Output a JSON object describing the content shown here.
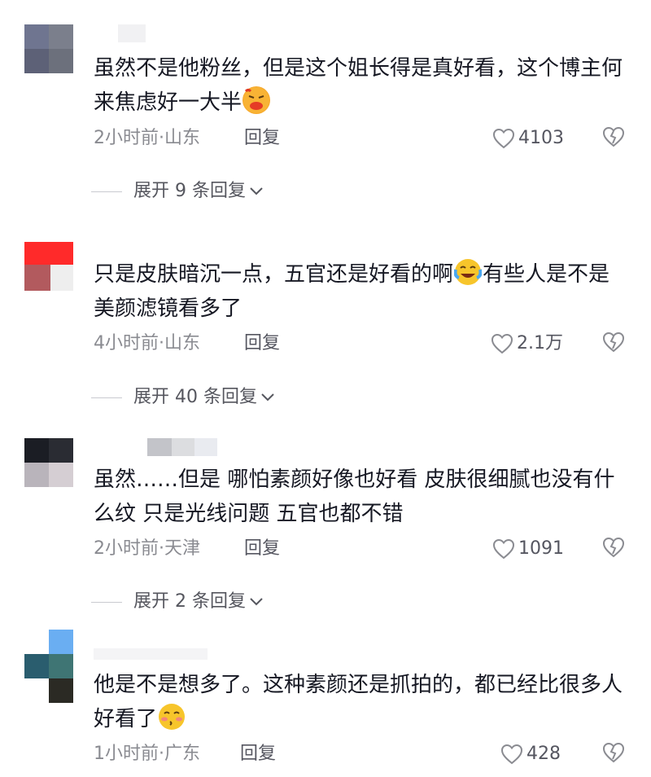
{
  "comments": [
    {
      "text_before_emoji": "虽然不是他粉丝，但是这个姐长得是真好看，这个博主何来焦虑好一大半",
      "text_after_emoji": "",
      "emoji": "tired-face-emoji",
      "time": "2小时前·山东",
      "reply_label": "回复",
      "likes": "4103",
      "expand_label": "展开 9 条回复"
    },
    {
      "text_before_emoji": "只是皮肤暗沉一点，五官还是好看的啊",
      "text_after_emoji": "有些人是不是美颜滤镜看多了",
      "emoji": "laughing-tears-emoji",
      "time": "4小时前·山东",
      "reply_label": "回复",
      "likes": "2.1万",
      "expand_label": "展开 40 条回复"
    },
    {
      "text_before_emoji": "虽然……但是 哪怕素颜好像也好看 皮肤很细腻也没有什么纹 只是光线问题 五官也都不错",
      "text_after_emoji": "",
      "emoji": "",
      "time": "2小时前·天津",
      "reply_label": "回复",
      "likes": "1091",
      "expand_label": "展开 2 条回复"
    },
    {
      "text_before_emoji": "他是不是想多了。这种素颜还是抓拍的，都已经比很多人好看了",
      "text_after_emoji": "",
      "emoji": "blushing-kiss-emoji",
      "time": "1小时前·广东",
      "reply_label": "回复",
      "likes": "428",
      "expand_label": ""
    }
  ],
  "colors": {
    "text": "#161823",
    "meta": "#8a8b91",
    "action": "#555660",
    "emoji_yellow": "#f7c52b"
  }
}
